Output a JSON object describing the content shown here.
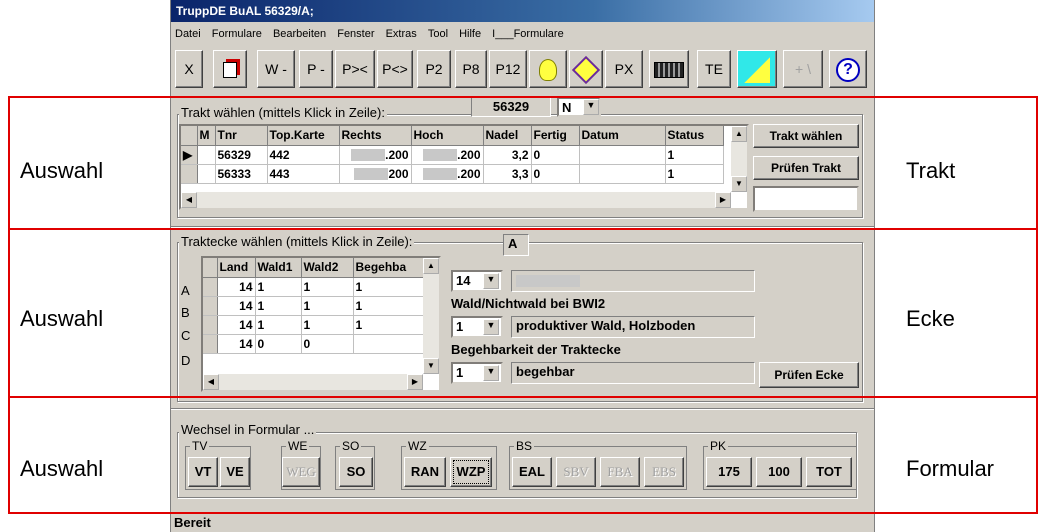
{
  "window": {
    "title": "TruppDE BuAL  56329/A;",
    "status": "Bereit"
  },
  "menu": [
    "Datei",
    "Formulare",
    "Bearbeiten",
    "Fenster",
    "Extras",
    "Tool",
    "Hilfe",
    "I___Formulare"
  ],
  "toolbar": {
    "buttons": [
      "X",
      "W -",
      "P -",
      "P><",
      "P<>",
      "P2",
      "P8",
      "P12",
      "PX",
      "TE"
    ]
  },
  "trakt": {
    "group_label": "Trakt wählen (mittels Klick in  Zeile):",
    "current_value": "56329",
    "mode_value": "N",
    "columns": [
      "M",
      "Tnr",
      "Top.Karte",
      "Rechts",
      "Hoch",
      "Nadel",
      "Fertig",
      "Datum",
      "Status"
    ],
    "rows": [
      {
        "m": "",
        "tnr": "56329",
        "karte": "442",
        "rechts": ".200",
        "hoch": ".200",
        "nadel": "3,2",
        "fertig": "0",
        "datum": "",
        "status": "1"
      },
      {
        "m": "",
        "tnr": "56333",
        "karte": "443",
        "rechts": "200",
        "hoch": ".200",
        "nadel": "3,3",
        "fertig": "0",
        "datum": "",
        "status": "1"
      }
    ],
    "btn_waehlen": "Trakt wählen",
    "btn_pruefen": "Prüfen Trakt"
  },
  "ecke": {
    "group_label": "Traktecke wählen (mittels Klick in Zeile):",
    "current_value": "A",
    "columns": [
      "Land",
      "Wald1",
      "Wald2",
      "Begehba"
    ],
    "row_labels": [
      "A",
      "B",
      "C",
      "D"
    ],
    "rows": [
      [
        "14",
        "1",
        "1",
        "1"
      ],
      [
        "14",
        "1",
        "1",
        "1"
      ],
      [
        "14",
        "1",
        "1",
        "1"
      ],
      [
        "14",
        "0",
        "0",
        ""
      ]
    ],
    "land_select": "14",
    "wald_label": "Wald/Nichtwald bei BWI2",
    "wald_select": "1",
    "wald_text": "produktiver Wald, Holzboden",
    "begeh_label": "Begehbarkeit der Traktecke",
    "begeh_select": "1",
    "begeh_text": "begehbar",
    "btn_pruefen": "Prüfen Ecke"
  },
  "formular": {
    "group_label": "Wechsel in Formular ...",
    "groups": [
      {
        "label": "TV",
        "buttons": [
          "VT",
          "VE"
        ]
      },
      {
        "label": "WE",
        "buttons": [
          "WEG"
        ]
      },
      {
        "label": "SO",
        "buttons": [
          "SO"
        ]
      },
      {
        "label": "WZ",
        "buttons": [
          "RAN",
          "WZP"
        ]
      },
      {
        "label": "BS",
        "buttons": [
          "EAL",
          "SBV",
          "FBA",
          "EBS"
        ]
      },
      {
        "label": "PK",
        "buttons": [
          "175",
          "100",
          "TOT"
        ]
      }
    ]
  },
  "annotations": {
    "left": [
      "Auswahl",
      "Auswahl",
      "Auswahl"
    ],
    "right": [
      "Trakt",
      "Ecke",
      "Formular"
    ],
    "box_color": "#e00000"
  }
}
